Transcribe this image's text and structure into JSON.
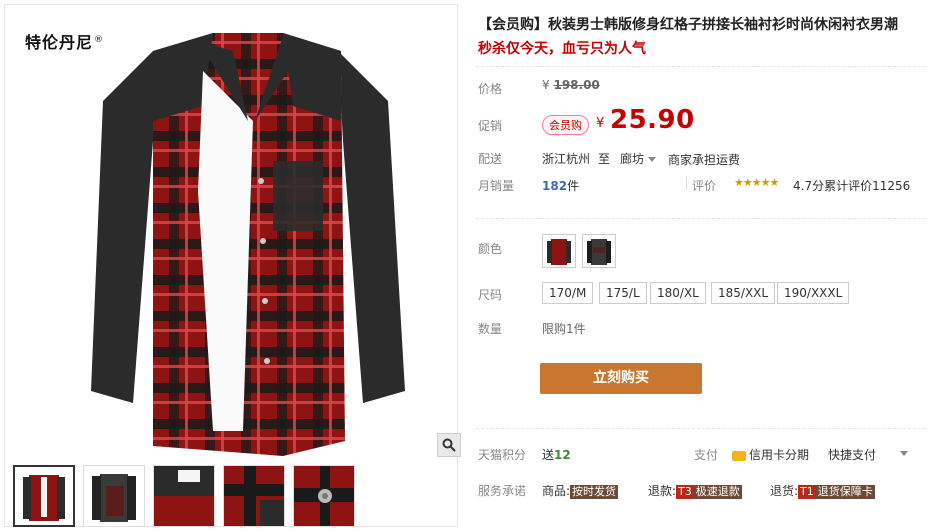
{
  "brand": {
    "name": "特伦丹尼",
    "mark": "®"
  },
  "product": {
    "title": "【会员购】秋装男士韩版修身红格子拼接长袖衬衫时尚休闲衬衣男潮",
    "subtitle": "秒杀仅今天，血亏只为人气"
  },
  "price": {
    "label": "价格",
    "currency": "¥",
    "original": "198.00"
  },
  "promo": {
    "label": "促销",
    "badge": "会员购",
    "currency": "¥",
    "price": "25.90"
  },
  "shipping": {
    "label": "配送",
    "from": "浙江杭州",
    "to_word": "至",
    "destination": "廊坊",
    "fee": "商家承担运费"
  },
  "sales": {
    "label": "月销量",
    "count": "182",
    "unit": "件",
    "rating_label": "评价",
    "stars": "★★★★★",
    "rating_score": 4.7,
    "rating_text": "4.7分累计评价11256"
  },
  "color": {
    "label": "颜色",
    "options": [
      "red-plaid",
      "dark-plaid"
    ]
  },
  "size": {
    "label": "尺码",
    "options": [
      "170/M",
      "175/L",
      "180/XL",
      "185/XXL",
      "190/XXXL"
    ]
  },
  "quantity": {
    "label": "数量",
    "limit": "限购1件"
  },
  "buy_button": "立刻购买",
  "points": {
    "label": "天猫积分",
    "prefix": "送",
    "value": "12"
  },
  "payment": {
    "label": "支付",
    "credit": "信用卡分期",
    "quick": "快捷支付"
  },
  "service": {
    "label": "服务承诺",
    "goods_label": "商品:",
    "goods_tag": "按时发货",
    "refund_label": "退款:",
    "refund_code": "T3",
    "refund_tag": "极速退款",
    "return_label": "退货:",
    "return_code": "T1",
    "return_tag": "退货保障卡"
  },
  "colors": {
    "accent": "#c40000",
    "button": "#c9772f",
    "gold": "#f2b318"
  }
}
